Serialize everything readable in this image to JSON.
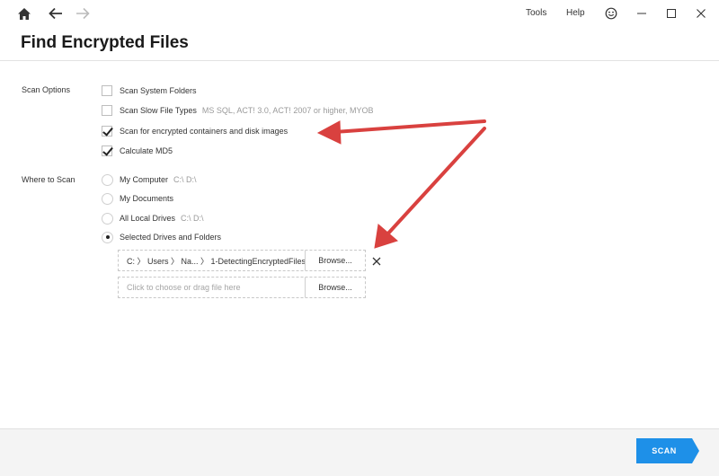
{
  "toolbar": {
    "home_icon": "home-icon",
    "back_icon": "arrow-left-icon",
    "forward_icon": "arrow-right-icon",
    "menu": [
      "Tools",
      "Help"
    ],
    "feedback_icon": "smiley-icon"
  },
  "window_controls": [
    "minimize-icon",
    "maximize-icon",
    "close-icon"
  ],
  "page": {
    "title": "Find Encrypted Files"
  },
  "scan_options": {
    "label": "Scan Options",
    "items": [
      {
        "label": "Scan System Folders",
        "hint": "",
        "checked": false
      },
      {
        "label": "Scan Slow File Types",
        "hint": "MS SQL, ACT! 3.0, ACT! 2007 or higher, MYOB",
        "checked": false
      },
      {
        "label": "Scan for encrypted containers and disk images",
        "hint": "",
        "checked": true
      },
      {
        "label": "Calculate MD5",
        "hint": "",
        "checked": true
      }
    ]
  },
  "where_to_scan": {
    "label": "Where to Scan",
    "items": [
      {
        "label": "My Computer",
        "hint": "C:\\ D:\\",
        "selected": false
      },
      {
        "label": "My Documents",
        "hint": "",
        "selected": false
      },
      {
        "label": "All Local Drives",
        "hint": "C:\\ D:\\",
        "selected": false
      },
      {
        "label": "Selected Drives and Folders",
        "hint": "",
        "selected": true
      }
    ],
    "paths": [
      {
        "value": "C: 〉 Users 〉 Na... 〉 1-DetectingEncryptedFiles",
        "browse_label": "Browse..."
      },
      {
        "value": "",
        "placeholder": "Click to choose or drag file here",
        "browse_label": "Browse..."
      }
    ]
  },
  "footer": {
    "scan_label": "SCAN"
  },
  "colors": {
    "accent": "#1e90e8",
    "annotation_arrow": "#d9413f",
    "footer_bg": "#f4f4f4"
  }
}
